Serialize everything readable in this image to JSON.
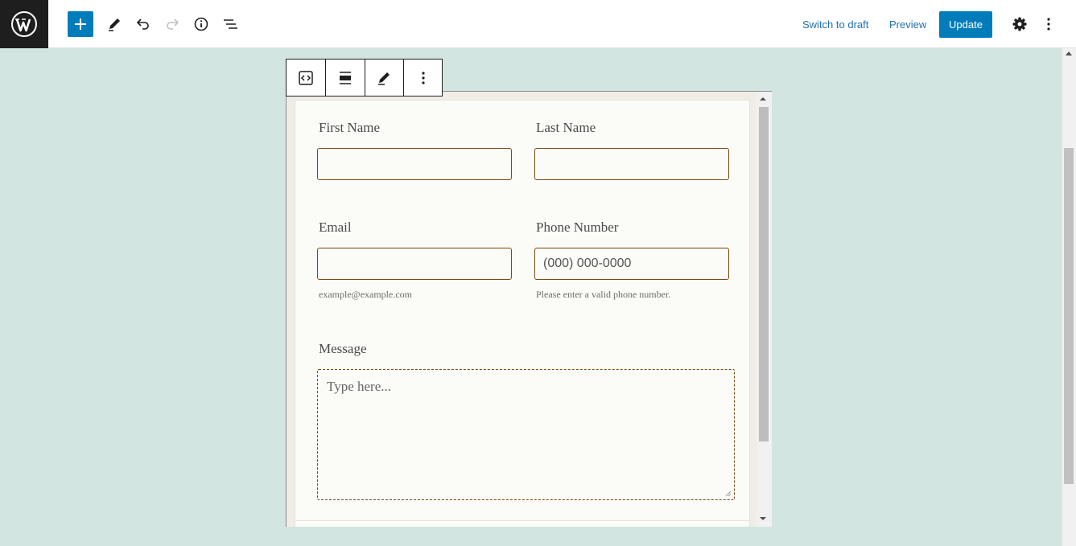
{
  "toolbar": {
    "switch_to_draft": "Switch to draft",
    "preview": "Preview",
    "update": "Update"
  },
  "icons": [
    "wordpress-logo",
    "plus-icon",
    "pencil-icon",
    "undo-icon",
    "redo-icon",
    "info-icon",
    "list-view-icon",
    "gear-icon",
    "kebab-icon",
    "code-icon",
    "align-icon",
    "edit-icon",
    "more-icon"
  ],
  "colors": {
    "accent": "#007cba",
    "link": "#2271b1",
    "canvas": "#d3e5e0",
    "field_border": "#7a4a10"
  },
  "form": {
    "first_name_label": "First Name",
    "last_name_label": "Last Name",
    "email_label": "Email",
    "email_hint": "example@example.com",
    "phone_label": "Phone Number",
    "phone_placeholder": "(000) 000-0000",
    "phone_hint": "Please enter a valid phone number.",
    "message_label": "Message",
    "message_placeholder": "Type here..."
  }
}
